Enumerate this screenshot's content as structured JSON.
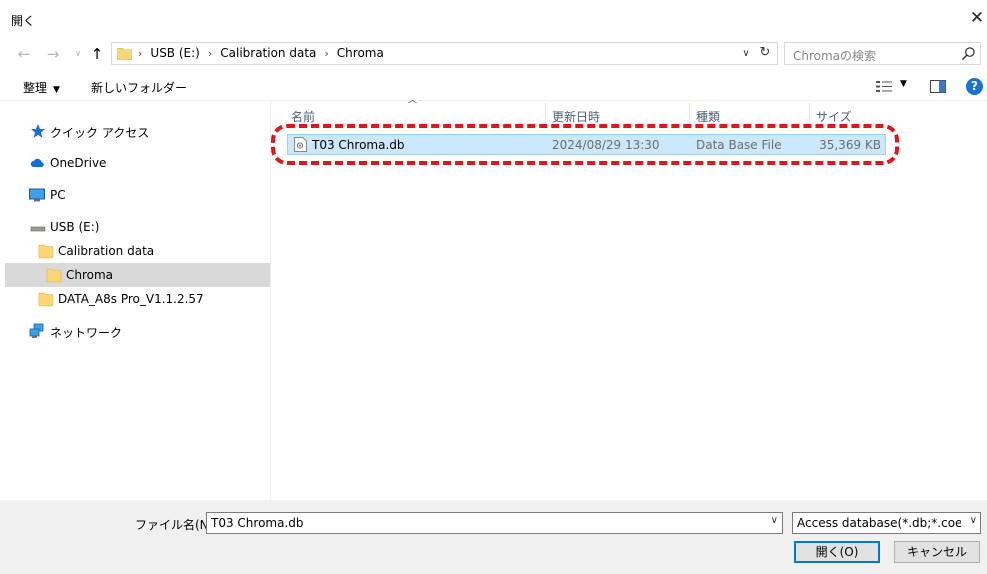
{
  "window": {
    "title": "開く"
  },
  "address": {
    "crumbs": [
      "USB (E:)",
      "Calibration data",
      "Chroma"
    ],
    "search_placeholder": "Chromaの検索"
  },
  "toolbar": {
    "organize": "整理",
    "new_folder": "新しいフォルダー"
  },
  "nav": {
    "quick_access": "クイック アクセス",
    "onedrive": "OneDrive",
    "pc": "PC",
    "usb": "USB (E:)",
    "calibration": "Calibration data",
    "chroma": "Chroma",
    "data_a8s": "DATA_A8s Pro_V1.1.2.57",
    "network": "ネットワーク"
  },
  "columns": {
    "name": "名前",
    "date": "更新日時",
    "type": "種類",
    "size": "サイズ"
  },
  "files": [
    {
      "name": "T03 Chroma.db",
      "date": "2024/08/29 13:30",
      "type": "Data Base File",
      "size": "35,369 KB"
    }
  ],
  "bottom": {
    "filename_label": "ファイル名(N):",
    "filename_value": "T03 Chroma.db",
    "filetype_value": "Access database(*.db;*.coef;*.sc",
    "open_button": "開く(O)",
    "cancel_button": "キャンセル"
  },
  "colors": {
    "selected_row": "#cce8ff",
    "highlight": "#e0161b",
    "accent": "#0078d7"
  }
}
